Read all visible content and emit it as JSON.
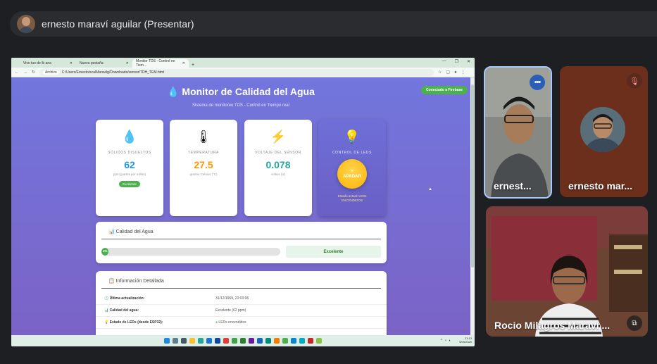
{
  "meeting": {
    "presenter_label": "ernesto maraví aguilar (Presentar)"
  },
  "browser": {
    "tabs": [
      {
        "label": "Vivo tuo de lb ana",
        "active": false
      },
      {
        "label": "Nueva pestaña",
        "active": false
      },
      {
        "label": "Monitor TDS - Control en Tiem...",
        "active": true
      }
    ],
    "new_tab": "+",
    "address_chip": "Archivo",
    "url": "C:/Users/Ernesto/scalMaravilg/Downloads/sensor/TDH_TEM.html"
  },
  "app": {
    "title": "Monitor de Calidad del Agua",
    "subtitle": "Sistema de monitoreo TDS - Control en Tiempo real",
    "firebase_badge": "Conectado a Firebase",
    "cards": [
      {
        "icon": "droplet-icon",
        "glyph": "💧",
        "label": "Sólidos disueltos",
        "value": "62",
        "unit": "ppm (partes por millón)",
        "value_color": "#2196f3",
        "badge": "Excelente"
      },
      {
        "icon": "thermometer-icon",
        "glyph": "🌡",
        "label": "Temperatura",
        "value": "27.5",
        "unit": "grados Celsius (°C)",
        "value_color": "#ff9800"
      },
      {
        "icon": "lightning-icon",
        "glyph": "⚡",
        "label": "Voltaje del sensor",
        "value": "0.078",
        "unit": "voltios (V)",
        "value_color": "#26a69a"
      },
      {
        "icon": "lightbulb-icon",
        "glyph": "💡",
        "label": "Control de LEDs",
        "button": "APAGAR",
        "state": "Estado actual: LEDs",
        "state2": "ENCENDIDOS"
      }
    ],
    "quality_panel": {
      "title": "Calidad del Agua",
      "progress_percent": 4,
      "progress_label": "4%",
      "quality": "Excelente"
    },
    "info_panel": {
      "title": "Información Detallada",
      "rows": [
        {
          "key": "Última actualización:",
          "value": "31/12/1969, 22:03:06"
        },
        {
          "key": "Calidad del agua:",
          "value": "Excelente (62 ppm)"
        },
        {
          "key": "Estado de LEDs (desde ESP32):",
          "value": "LEDs encendidos"
        }
      ]
    }
  },
  "taskbar": {
    "time": "23:13",
    "date": "5/05/2025"
  },
  "participants": [
    {
      "name": "ernest...",
      "control": "more-options"
    },
    {
      "name": "ernesto mar...",
      "control": "muted"
    },
    {
      "name": "Rocio Milagros Maraví ...",
      "control": "pip"
    }
  ],
  "colors": {
    "page_gradient_top": "#7276dd",
    "page_gradient_bottom": "#7b63c6",
    "accent_green": "#4caf50",
    "speaking_border": "#a8c7fa"
  }
}
